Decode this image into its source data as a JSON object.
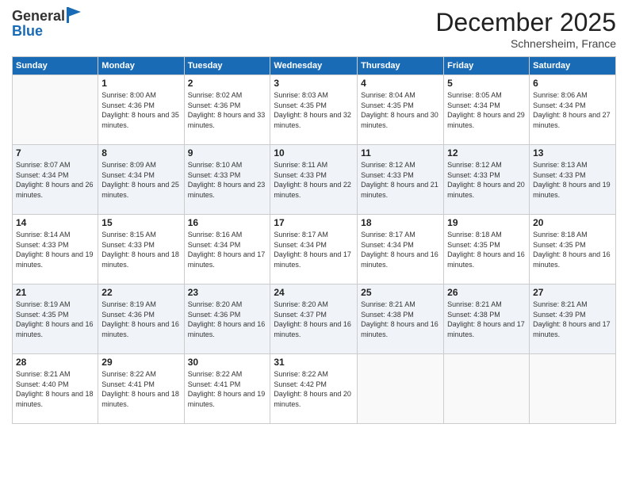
{
  "logo": {
    "general": "General",
    "blue": "Blue"
  },
  "header": {
    "month": "December 2025",
    "location": "Schnersheim, France"
  },
  "days_header": [
    "Sunday",
    "Monday",
    "Tuesday",
    "Wednesday",
    "Thursday",
    "Friday",
    "Saturday"
  ],
  "weeks": [
    [
      {
        "day": "",
        "sunrise": "",
        "sunset": "",
        "daylight": "",
        "empty": true
      },
      {
        "day": "1",
        "sunrise": "Sunrise: 8:00 AM",
        "sunset": "Sunset: 4:36 PM",
        "daylight": "Daylight: 8 hours and 35 minutes."
      },
      {
        "day": "2",
        "sunrise": "Sunrise: 8:02 AM",
        "sunset": "Sunset: 4:36 PM",
        "daylight": "Daylight: 8 hours and 33 minutes."
      },
      {
        "day": "3",
        "sunrise": "Sunrise: 8:03 AM",
        "sunset": "Sunset: 4:35 PM",
        "daylight": "Daylight: 8 hours and 32 minutes."
      },
      {
        "day": "4",
        "sunrise": "Sunrise: 8:04 AM",
        "sunset": "Sunset: 4:35 PM",
        "daylight": "Daylight: 8 hours and 30 minutes."
      },
      {
        "day": "5",
        "sunrise": "Sunrise: 8:05 AM",
        "sunset": "Sunset: 4:34 PM",
        "daylight": "Daylight: 8 hours and 29 minutes."
      },
      {
        "day": "6",
        "sunrise": "Sunrise: 8:06 AM",
        "sunset": "Sunset: 4:34 PM",
        "daylight": "Daylight: 8 hours and 27 minutes."
      }
    ],
    [
      {
        "day": "7",
        "sunrise": "Sunrise: 8:07 AM",
        "sunset": "Sunset: 4:34 PM",
        "daylight": "Daylight: 8 hours and 26 minutes."
      },
      {
        "day": "8",
        "sunrise": "Sunrise: 8:09 AM",
        "sunset": "Sunset: 4:34 PM",
        "daylight": "Daylight: 8 hours and 25 minutes."
      },
      {
        "day": "9",
        "sunrise": "Sunrise: 8:10 AM",
        "sunset": "Sunset: 4:33 PM",
        "daylight": "Daylight: 8 hours and 23 minutes."
      },
      {
        "day": "10",
        "sunrise": "Sunrise: 8:11 AM",
        "sunset": "Sunset: 4:33 PM",
        "daylight": "Daylight: 8 hours and 22 minutes."
      },
      {
        "day": "11",
        "sunrise": "Sunrise: 8:12 AM",
        "sunset": "Sunset: 4:33 PM",
        "daylight": "Daylight: 8 hours and 21 minutes."
      },
      {
        "day": "12",
        "sunrise": "Sunrise: 8:12 AM",
        "sunset": "Sunset: 4:33 PM",
        "daylight": "Daylight: 8 hours and 20 minutes."
      },
      {
        "day": "13",
        "sunrise": "Sunrise: 8:13 AM",
        "sunset": "Sunset: 4:33 PM",
        "daylight": "Daylight: 8 hours and 19 minutes."
      }
    ],
    [
      {
        "day": "14",
        "sunrise": "Sunrise: 8:14 AM",
        "sunset": "Sunset: 4:33 PM",
        "daylight": "Daylight: 8 hours and 19 minutes."
      },
      {
        "day": "15",
        "sunrise": "Sunrise: 8:15 AM",
        "sunset": "Sunset: 4:33 PM",
        "daylight": "Daylight: 8 hours and 18 minutes."
      },
      {
        "day": "16",
        "sunrise": "Sunrise: 8:16 AM",
        "sunset": "Sunset: 4:34 PM",
        "daylight": "Daylight: 8 hours and 17 minutes."
      },
      {
        "day": "17",
        "sunrise": "Sunrise: 8:17 AM",
        "sunset": "Sunset: 4:34 PM",
        "daylight": "Daylight: 8 hours and 17 minutes."
      },
      {
        "day": "18",
        "sunrise": "Sunrise: 8:17 AM",
        "sunset": "Sunset: 4:34 PM",
        "daylight": "Daylight: 8 hours and 16 minutes."
      },
      {
        "day": "19",
        "sunrise": "Sunrise: 8:18 AM",
        "sunset": "Sunset: 4:35 PM",
        "daylight": "Daylight: 8 hours and 16 minutes."
      },
      {
        "day": "20",
        "sunrise": "Sunrise: 8:18 AM",
        "sunset": "Sunset: 4:35 PM",
        "daylight": "Daylight: 8 hours and 16 minutes."
      }
    ],
    [
      {
        "day": "21",
        "sunrise": "Sunrise: 8:19 AM",
        "sunset": "Sunset: 4:35 PM",
        "daylight": "Daylight: 8 hours and 16 minutes."
      },
      {
        "day": "22",
        "sunrise": "Sunrise: 8:19 AM",
        "sunset": "Sunset: 4:36 PM",
        "daylight": "Daylight: 8 hours and 16 minutes."
      },
      {
        "day": "23",
        "sunrise": "Sunrise: 8:20 AM",
        "sunset": "Sunset: 4:36 PM",
        "daylight": "Daylight: 8 hours and 16 minutes."
      },
      {
        "day": "24",
        "sunrise": "Sunrise: 8:20 AM",
        "sunset": "Sunset: 4:37 PM",
        "daylight": "Daylight: 8 hours and 16 minutes."
      },
      {
        "day": "25",
        "sunrise": "Sunrise: 8:21 AM",
        "sunset": "Sunset: 4:38 PM",
        "daylight": "Daylight: 8 hours and 16 minutes."
      },
      {
        "day": "26",
        "sunrise": "Sunrise: 8:21 AM",
        "sunset": "Sunset: 4:38 PM",
        "daylight": "Daylight: 8 hours and 17 minutes."
      },
      {
        "day": "27",
        "sunrise": "Sunrise: 8:21 AM",
        "sunset": "Sunset: 4:39 PM",
        "daylight": "Daylight: 8 hours and 17 minutes."
      }
    ],
    [
      {
        "day": "28",
        "sunrise": "Sunrise: 8:21 AM",
        "sunset": "Sunset: 4:40 PM",
        "daylight": "Daylight: 8 hours and 18 minutes."
      },
      {
        "day": "29",
        "sunrise": "Sunrise: 8:22 AM",
        "sunset": "Sunset: 4:41 PM",
        "daylight": "Daylight: 8 hours and 18 minutes."
      },
      {
        "day": "30",
        "sunrise": "Sunrise: 8:22 AM",
        "sunset": "Sunset: 4:41 PM",
        "daylight": "Daylight: 8 hours and 19 minutes."
      },
      {
        "day": "31",
        "sunrise": "Sunrise: 8:22 AM",
        "sunset": "Sunset: 4:42 PM",
        "daylight": "Daylight: 8 hours and 20 minutes."
      },
      {
        "day": "",
        "sunrise": "",
        "sunset": "",
        "daylight": "",
        "empty": true
      },
      {
        "day": "",
        "sunrise": "",
        "sunset": "",
        "daylight": "",
        "empty": true
      },
      {
        "day": "",
        "sunrise": "",
        "sunset": "",
        "daylight": "",
        "empty": true
      }
    ]
  ]
}
